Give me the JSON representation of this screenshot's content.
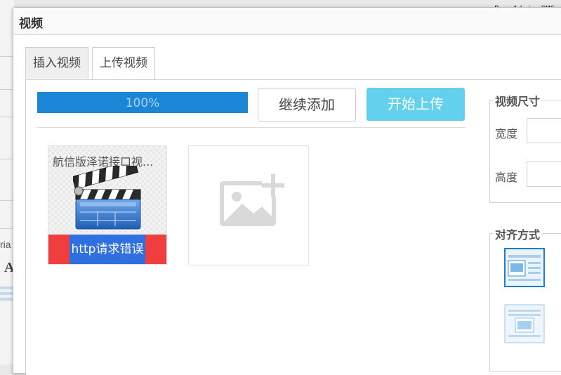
{
  "background": {
    "partial_text": "ria",
    "brand": "PageAdmin CMS"
  },
  "dialog": {
    "title": "视频"
  },
  "tabs": [
    {
      "label": "插入视频",
      "active": false
    },
    {
      "label": "上传视频",
      "active": true
    }
  ],
  "upload": {
    "progress": {
      "percent": 100,
      "label": "100%"
    },
    "add_more_label": "继续添加",
    "start_label": "开始上传",
    "files": [
      {
        "name": "航信版泽诺接口视...",
        "status": "http请求错误",
        "icon": "video-clapperboard-icon"
      }
    ],
    "add_slot_icon": "add-image-icon"
  },
  "size": {
    "legend": "视频尺寸",
    "width_label": "宽度",
    "height_label": "高度",
    "width_value": "",
    "height_value": ""
  },
  "align": {
    "legend": "对齐方式",
    "options": [
      "align-left-icon",
      "align-center-icon"
    ]
  },
  "colors": {
    "accent": "#1b86d5",
    "start_button": "#63d1ee",
    "error": "#f03d3d",
    "error_inner": "#2f6fe0"
  }
}
